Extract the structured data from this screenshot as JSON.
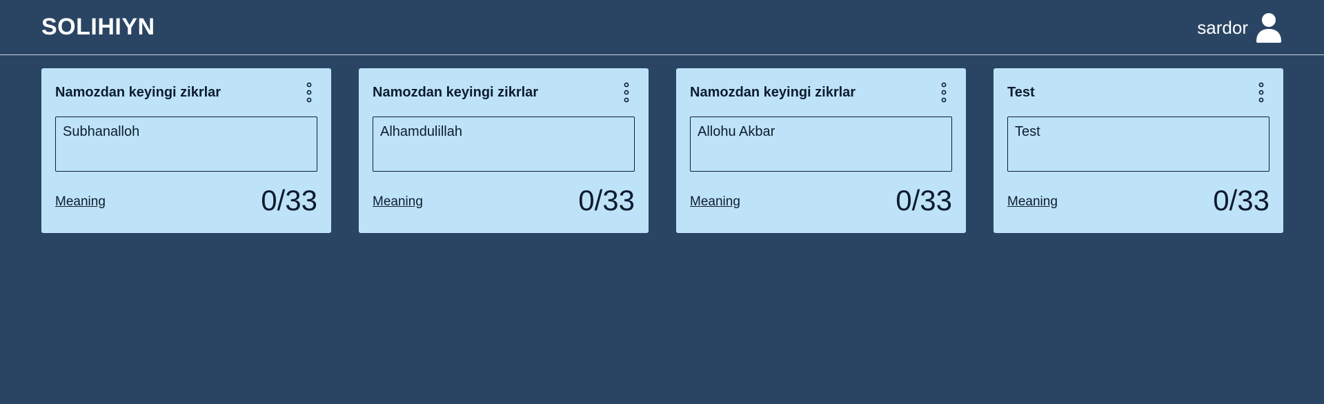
{
  "header": {
    "brand": "SOLIHIYN",
    "username": "sardor",
    "user_icon": "user-icon"
  },
  "colors": {
    "background": "#2a4563",
    "card": "#bee3f8",
    "text_dark": "#0d1b2e",
    "header_text": "#ffffff"
  },
  "cards": [
    {
      "title": "Namozdan keyingi zikrlar",
      "text": "Subhanalloh",
      "meaning_label": "Meaning",
      "counter": "0/33",
      "menu_icon": "more-vertical-icon"
    },
    {
      "title": "Namozdan keyingi zikrlar",
      "text": "Alhamdulillah",
      "meaning_label": "Meaning",
      "counter": "0/33",
      "menu_icon": "more-vertical-icon"
    },
    {
      "title": "Namozdan keyingi zikrlar",
      "text": "Allohu Akbar",
      "meaning_label": "Meaning",
      "counter": "0/33",
      "menu_icon": "more-vertical-icon"
    },
    {
      "title": "Test",
      "text": "Test",
      "meaning_label": "Meaning",
      "counter": "0/33",
      "menu_icon": "more-vertical-icon"
    }
  ]
}
